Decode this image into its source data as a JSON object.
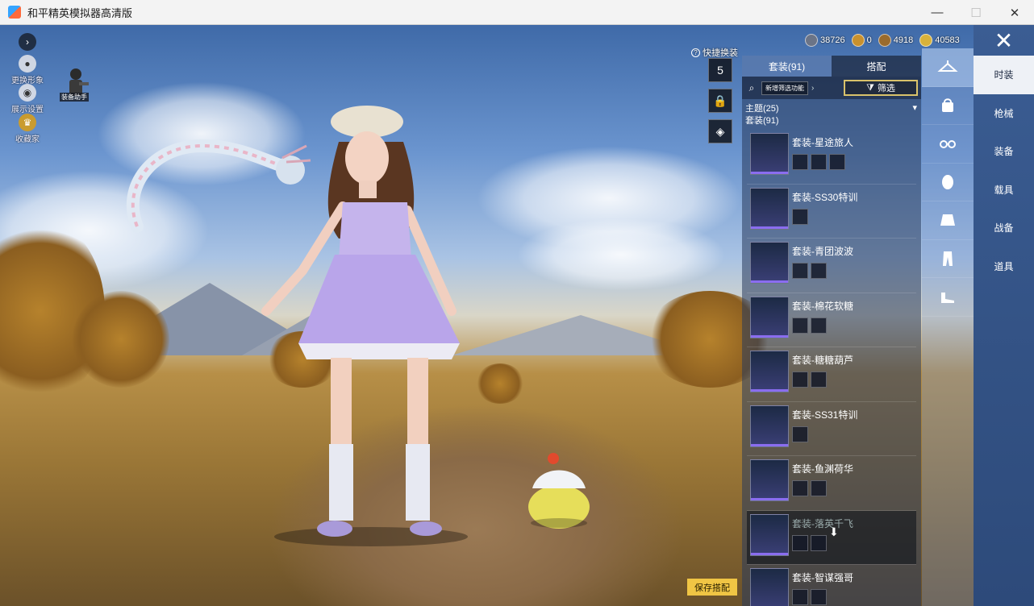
{
  "window": {
    "title": "和平精英模拟器高清版",
    "minimize": "—",
    "maximize": "☐",
    "close": "✕"
  },
  "left_controls": {
    "expand_icon": "›",
    "change_look": "更换形象",
    "display_settings": "展示设置",
    "collection": "收藏家",
    "assistant_tag": "装备助手"
  },
  "currencies": [
    {
      "icon": "diamond-coin-icon",
      "value": "38726",
      "color": "#6b7487"
    },
    {
      "icon": "a-coin-icon",
      "value": "0",
      "color": "#c9912e"
    },
    {
      "icon": "medal-coin-icon",
      "value": "4918",
      "color": "#9a6b2d"
    },
    {
      "icon": "gold-coin-icon",
      "value": "40583",
      "color": "#d8b23b"
    }
  ],
  "quick_switch": {
    "label": "快捷换装",
    "help": "?",
    "slot_number": "5"
  },
  "panel": {
    "tab_suits": "套装(91)",
    "tab_outfit": "搭配",
    "new_filter": "新增筛选功能",
    "filter": "筛选",
    "theme_label": "主题(25)",
    "suit_count": "套装(91)",
    "suits": [
      {
        "name": "套装-星途旅人",
        "pieces": 3
      },
      {
        "name": "套装-SS30特训",
        "pieces": 1
      },
      {
        "name": "套装-青团波波",
        "pieces": 2
      },
      {
        "name": "套装-棉花软糖",
        "pieces": 2
      },
      {
        "name": "套装-糖糖葫芦",
        "pieces": 2
      },
      {
        "name": "套装-SS31特训",
        "pieces": 1
      },
      {
        "name": "套装-鱼渊荷华",
        "pieces": 2
      },
      {
        "name": "套装-落英千飞",
        "pieces": 2
      },
      {
        "name": "套装-智谋强哥",
        "pieces": 2
      }
    ],
    "save": "保存搭配"
  },
  "categories": [
    "时装",
    "枪械",
    "装备",
    "载具",
    "战备",
    "道具"
  ],
  "accent": "#f0c544"
}
